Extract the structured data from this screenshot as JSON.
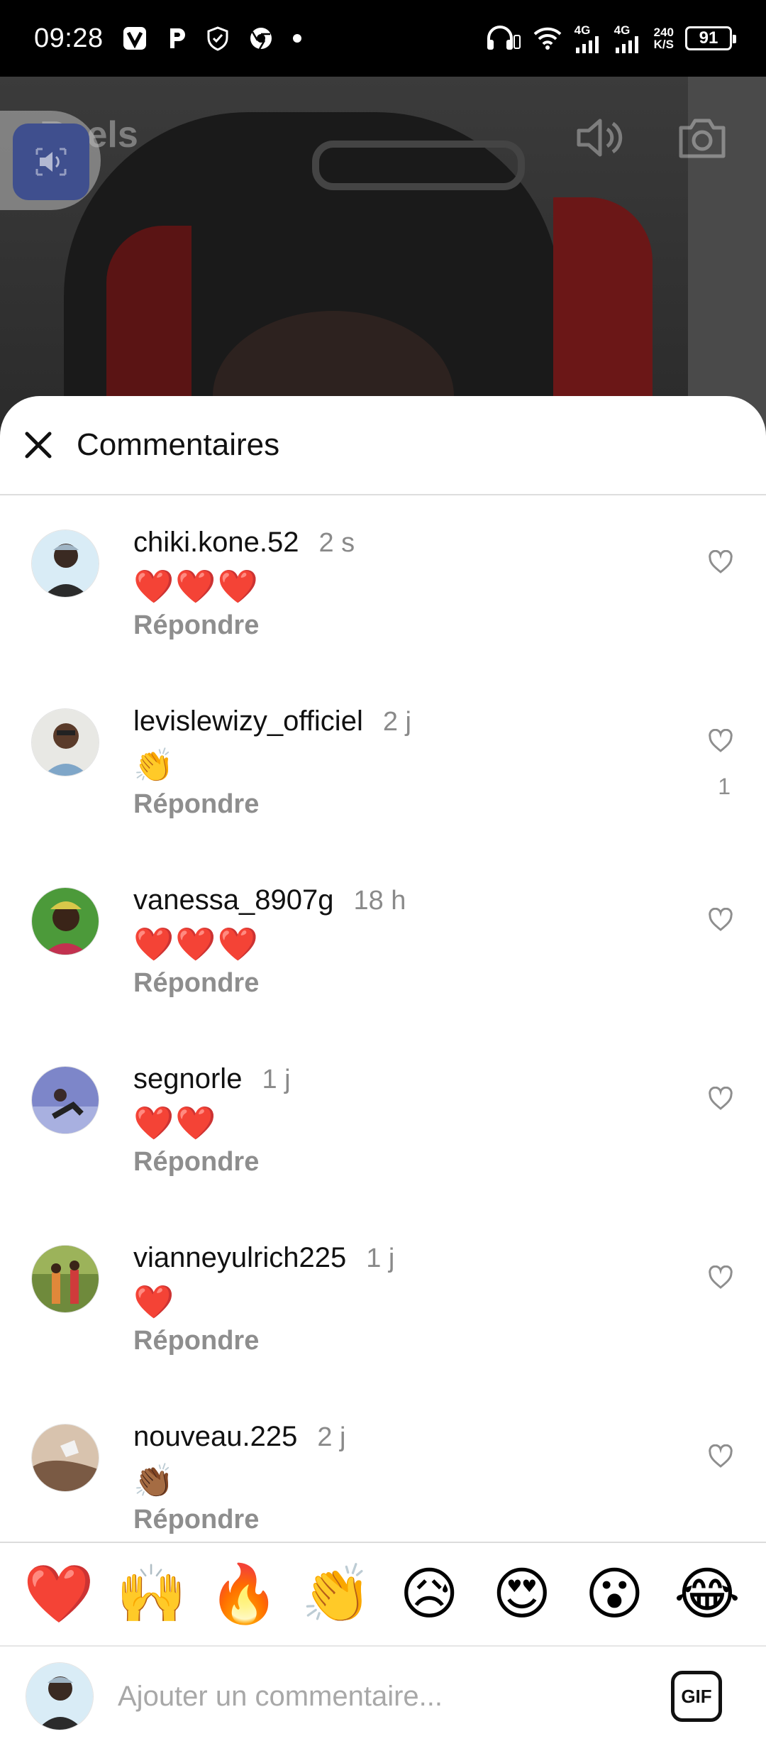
{
  "status_bar": {
    "time": "09:28",
    "net_label_1": "4G",
    "net_label_2": "4G",
    "speed_value": "240",
    "speed_unit": "K/S",
    "battery": "91"
  },
  "video": {
    "section_title": "Reels"
  },
  "sheet": {
    "title": "Commentaires"
  },
  "comments": [
    {
      "user": "chiki.kone.52",
      "time": "2 s",
      "text": "❤️❤️❤️",
      "reply": "Répondre",
      "likes": ""
    },
    {
      "user": "levislewizy_officiel",
      "time": "2 j",
      "text": "👏",
      "reply": "Répondre",
      "likes": "1"
    },
    {
      "user": "vanessa_8907g",
      "time": "18 h",
      "text": "❤️❤️❤️",
      "reply": "Répondre",
      "likes": ""
    },
    {
      "user": "segnorle",
      "time": "1 j",
      "text": "❤️❤️",
      "reply": "Répondre",
      "likes": ""
    },
    {
      "user": "vianneyulrich225",
      "time": "1 j",
      "text": "❤️",
      "reply": "Répondre",
      "likes": ""
    },
    {
      "user": "nouveau.225",
      "time": "2 j",
      "text": "👏🏾",
      "reply": "Répondre",
      "likes": ""
    }
  ],
  "emoji_bar": [
    "❤️",
    "🙌",
    "🔥",
    "👏",
    "😥",
    "😍",
    "😮",
    "😂"
  ],
  "composer": {
    "placeholder": "Ajouter un commentaire...",
    "gif_label": "GIF"
  },
  "colors": {
    "accent_badge": "#3f4f8e",
    "muted_text": "#8e8e8e"
  }
}
